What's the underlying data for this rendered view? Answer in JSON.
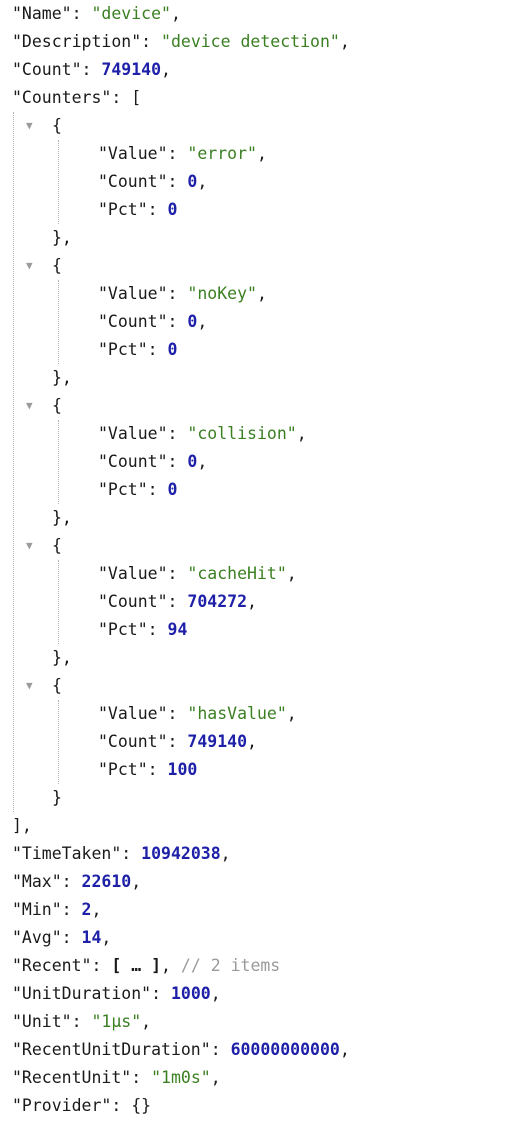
{
  "json": {
    "name_key": "\"Name\"",
    "name_val": "\"device\"",
    "description_key": "\"Description\"",
    "description_val": "\"device detection\"",
    "count_key": "\"Count\"",
    "count_val": "749140",
    "counters_key": "\"Counters\"",
    "counters": [
      {
        "value": "\"error\"",
        "count": "0",
        "pct": "0"
      },
      {
        "value": "\"noKey\"",
        "count": "0",
        "pct": "0"
      },
      {
        "value": "\"collision\"",
        "count": "0",
        "pct": "0"
      },
      {
        "value": "\"cacheHit\"",
        "count": "704272",
        "pct": "94"
      },
      {
        "value": "\"hasValue\"",
        "count": "749140",
        "pct": "100"
      }
    ],
    "counter_value_key": "\"Value\"",
    "counter_count_key": "\"Count\"",
    "counter_pct_key": "\"Pct\"",
    "timetaken_key": "\"TimeTaken\"",
    "timetaken_val": "10942038",
    "max_key": "\"Max\"",
    "max_val": "22610",
    "min_key": "\"Min\"",
    "min_val": "2",
    "avg_key": "\"Avg\"",
    "avg_val": "14",
    "recent_key": "\"Recent\"",
    "recent_collapsed": "[ … ]",
    "recent_comment": "// 2 items",
    "unitduration_key": "\"UnitDuration\"",
    "unitduration_val": "1000",
    "unit_key": "\"Unit\"",
    "unit_val": "\"1µs\"",
    "recentunitduration_key": "\"RecentUnitDuration\"",
    "recentunitduration_val": "60000000000",
    "recentunit_key": "\"RecentUnit\"",
    "recentunit_val": "\"1m0s\"",
    "provider_key": "\"Provider\"",
    "provider_val": "{}"
  },
  "icons": {
    "toggle": "triangle-down"
  }
}
